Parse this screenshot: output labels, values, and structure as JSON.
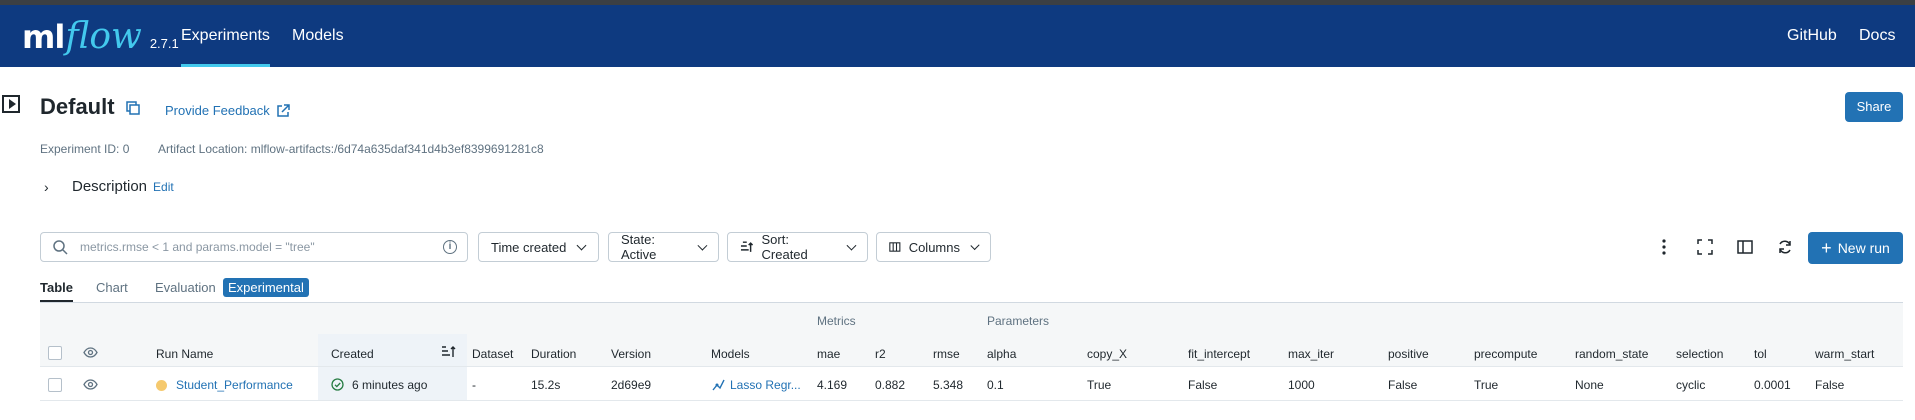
{
  "navbar": {
    "logo_ml": "ml",
    "logo_flow": "flow",
    "version": "2.7.1",
    "tabs": [
      {
        "label": "Experiments"
      },
      {
        "label": "Models"
      }
    ],
    "right_links": [
      {
        "label": "GitHub"
      },
      {
        "label": "Docs"
      }
    ]
  },
  "header": {
    "title": "Default",
    "feedback_label": "Provide Feedback",
    "share_label": "Share",
    "experiment_id_label": "Experiment ID:",
    "experiment_id": "0",
    "artifact_label": "Artifact Location:",
    "artifact_location": "mlflow-artifacts:/6d74a635daf341d4b3ef8399691281c8",
    "description_label": "Description",
    "edit_label": "Edit"
  },
  "toolbar": {
    "search_placeholder": "metrics.rmse < 1 and params.model = \"tree\"",
    "time_created": "Time created",
    "state": "State: Active",
    "sort": "Sort: Created",
    "columns": "Columns",
    "new_run": "New run"
  },
  "view_tabs": [
    {
      "label": "Table"
    },
    {
      "label": "Chart"
    },
    {
      "label": "Evaluation"
    }
  ],
  "experimental_badge": "Experimental",
  "table": {
    "groups": {
      "metrics": "Metrics",
      "parameters": "Parameters"
    },
    "columns": [
      "Run Name",
      "Created",
      "Dataset",
      "Duration",
      "Version",
      "Models",
      "mae",
      "r2",
      "rmse",
      "alpha",
      "copy_X",
      "fit_intercept",
      "max_iter",
      "positive",
      "precompute",
      "random_state",
      "selection",
      "tol",
      "warm_start"
    ],
    "rows": [
      {
        "run_name": "Student_Performance",
        "created": "6 minutes ago",
        "dataset": "-",
        "duration": "15.2s",
        "version": "2d69e9",
        "model": "Lasso Regr...",
        "mae": "4.169",
        "r2": "0.882",
        "rmse": "5.348",
        "alpha": "0.1",
        "copy_X": "True",
        "fit_intercept": "False",
        "max_iter": "1000",
        "positive": "False",
        "precompute": "True",
        "random_state": "None",
        "selection": "cyclic",
        "tol": "0.0001",
        "warm_start": "False"
      }
    ]
  },
  "colors": {
    "navbar": "#0e3a80",
    "accent": "#2272b4",
    "logo_flow": "#43c9ed",
    "run_dot": "#f5c96e"
  }
}
